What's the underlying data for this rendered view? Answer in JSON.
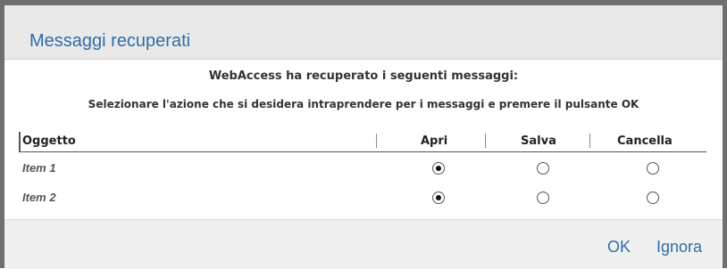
{
  "dialog": {
    "title": "Messaggi recuperati",
    "heading": "WebAccess ha recuperato i seguenti messaggi:",
    "subheading": "Selezionare l'azione che si desidera intraprendere per i messaggi e premere il pulsante OK"
  },
  "table": {
    "columns": [
      "Oggetto",
      "Apri",
      "Salva",
      "Cancella"
    ],
    "rows": [
      {
        "label": "Item 1",
        "selected": "Apri"
      },
      {
        "label": "Item 2",
        "selected": "Apri"
      }
    ]
  },
  "footer": {
    "ok_label": "OK",
    "ignore_label": "Ignora"
  },
  "colors": {
    "accent": "#2f6ea8",
    "frame": "#6f6f6f"
  }
}
